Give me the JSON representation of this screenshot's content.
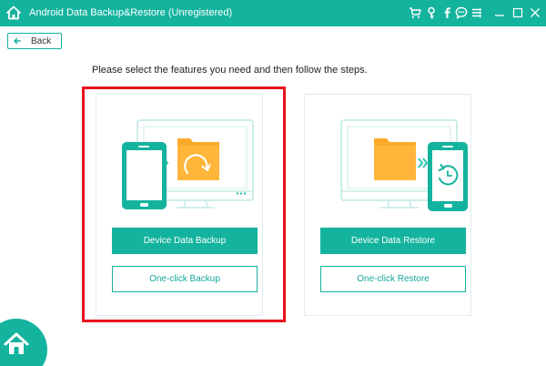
{
  "window": {
    "title": "Android Data Backup&Restore (Unregistered)"
  },
  "toolbar": {
    "icons": [
      "cart-icon",
      "key-icon",
      "facebook-icon",
      "chat-icon",
      "menu-icon",
      "minimize-icon",
      "maximize-icon",
      "close-icon"
    ]
  },
  "nav": {
    "back_label": "Back"
  },
  "main": {
    "instruction": "Please select the features you need and then follow the steps."
  },
  "backup": {
    "primary_label": "Device Data Backup",
    "secondary_label": "One-click Backup"
  },
  "restore": {
    "primary_label": "Device Data Restore",
    "secondary_label": "One-click Restore"
  },
  "colors": {
    "accent": "#14b39e",
    "highlight": "#e8111d",
    "folder": "#fcaa2a"
  }
}
